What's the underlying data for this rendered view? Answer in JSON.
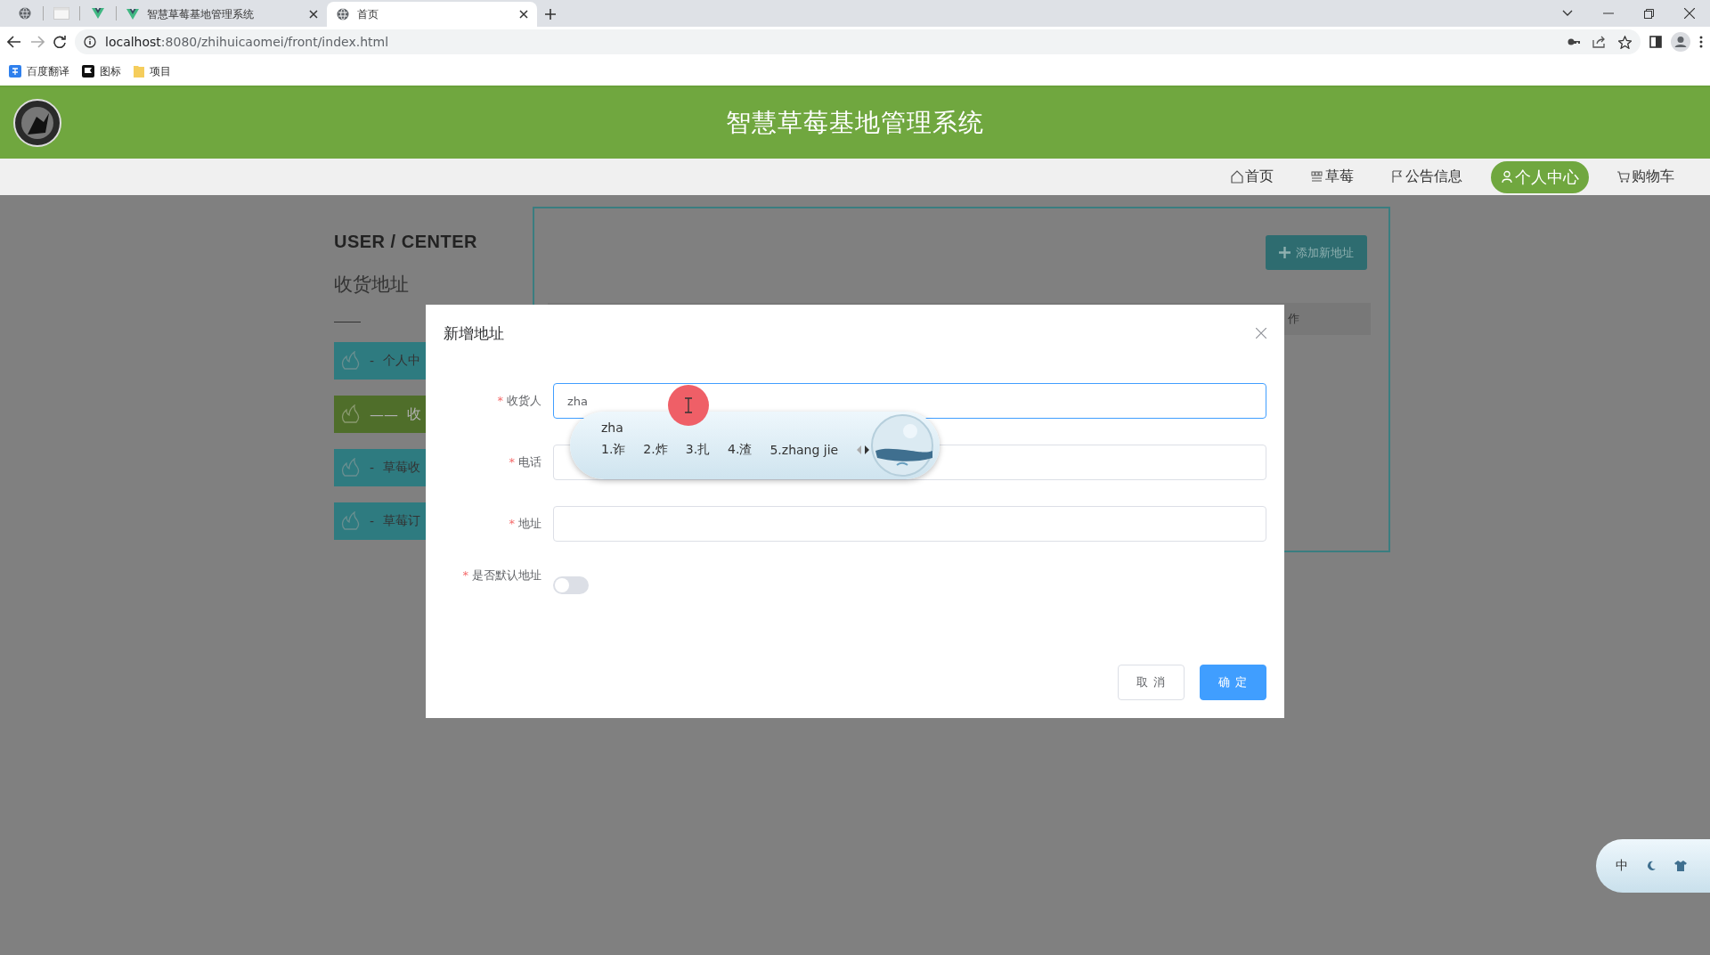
{
  "browser": {
    "tabs": [
      {
        "title": "智慧草莓基地管理系统",
        "selected": false
      },
      {
        "title": "首页",
        "selected": true
      }
    ],
    "address": {
      "host": "localhost",
      "path": ":8080/zhihuicaomei/front/index.html"
    },
    "bookmarks": [
      "百度翻译",
      "图标",
      "项目"
    ]
  },
  "header": {
    "title": "智慧草莓基地管理系统"
  },
  "nav": [
    {
      "label": "首页",
      "selected": false
    },
    {
      "label": "草莓",
      "selected": false
    },
    {
      "label": "公告信息",
      "selected": false
    },
    {
      "label": "个人中心",
      "selected": true
    },
    {
      "label": "购物车",
      "selected": false
    }
  ],
  "sidebar": {
    "heading": "USER / CENTER",
    "subtitle": "收货地址",
    "items": [
      {
        "prefix": "-",
        "label": "个人中",
        "selected": false
      },
      {
        "prefix": "——",
        "label": "收",
        "selected": true
      },
      {
        "prefix": "-",
        "label": "草莓收",
        "selected": false
      },
      {
        "prefix": "-",
        "label": "草莓订",
        "selected": false
      }
    ]
  },
  "panel": {
    "add_button": "添加新地址",
    "table": {
      "columns": [
        "作"
      ]
    }
  },
  "dialog": {
    "title": "新增地址",
    "fields": [
      {
        "kind": "text",
        "required_mark": "*",
        "label": "收货人",
        "value": "zha",
        "focused": true
      },
      {
        "kind": "text",
        "required_mark": "*",
        "label": "电话",
        "focused": false
      },
      {
        "kind": "text",
        "required_mark": "*",
        "label": "地址",
        "focused": false
      },
      {
        "kind": "switch",
        "required_mark": "*",
        "label": "是否默认地址",
        "on": false
      }
    ],
    "buttons": [
      {
        "kind": "default",
        "label": "取 消"
      },
      {
        "kind": "primary",
        "label": "确 定"
      }
    ]
  },
  "ime": {
    "composition": "zha",
    "candidates": [
      "1.诈",
      "2.炸",
      "3.扎",
      "4.渣",
      "5.zhang jie"
    ],
    "status": "中"
  }
}
